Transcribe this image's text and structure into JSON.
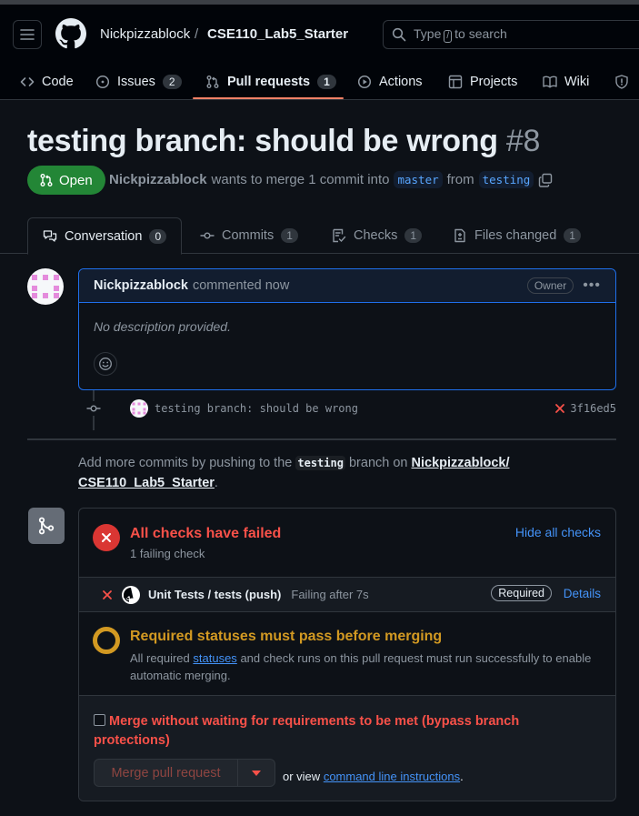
{
  "header": {
    "owner": "Nickpizzablock",
    "separator": "/",
    "repo": "CSE110_Lab5_Starter",
    "search_prefix": "Type",
    "search_key": "/",
    "search_suffix": "to search"
  },
  "repo_tabs": [
    {
      "label": "Code",
      "count": null,
      "icon": "code-icon"
    },
    {
      "label": "Issues",
      "count": "2",
      "icon": "issue-icon"
    },
    {
      "label": "Pull requests",
      "count": "1",
      "icon": "pull-request-icon"
    },
    {
      "label": "Actions",
      "count": null,
      "icon": "play-icon"
    },
    {
      "label": "Projects",
      "count": null,
      "icon": "table-icon"
    },
    {
      "label": "Wiki",
      "count": null,
      "icon": "book-icon"
    }
  ],
  "pr": {
    "title": "testing branch: should be wrong",
    "number": "#8",
    "state": "Open",
    "author": "Nickpizzablock",
    "merge_text": "wants to merge 1 commit into",
    "base_branch": "master",
    "from_text": "from",
    "head_branch": "testing"
  },
  "pr_tabs": [
    {
      "label": "Conversation",
      "count": "0"
    },
    {
      "label": "Commits",
      "count": "1"
    },
    {
      "label": "Checks",
      "count": "1"
    },
    {
      "label": "Files changed",
      "count": "1"
    }
  ],
  "comment": {
    "author": "Nickpizzablock",
    "time": "commented now",
    "badge": "Owner",
    "body": "No description provided."
  },
  "commit": {
    "message": "testing branch: should be wrong",
    "sha": "3f16ed5"
  },
  "add_commits": {
    "prefix": "Add more commits by pushing to the",
    "branch": "testing",
    "middle": "branch on",
    "repo_line1": "Nickpizzablock/",
    "repo_line2": "CSE110_Lab5_Starter",
    "suffix": "."
  },
  "checks": {
    "title": "All checks have failed",
    "subtitle": "1 failing check",
    "hide_label": "Hide all checks",
    "check_name": "Unit Tests / tests (push)",
    "check_status": "Failing after 7s",
    "required_badge": "Required",
    "details_label": "Details"
  },
  "requirements": {
    "title": "Required statuses must pass before merging",
    "desc_prefix": "All required",
    "desc_link": "statuses",
    "desc_suffix": "and check runs on this pull request must run successfully to enable automatic merging."
  },
  "merge": {
    "bypass_label": "Merge without waiting for requirements to be met (bypass branch protections)",
    "button_label": "Merge pull request",
    "or_view": "or view",
    "cli_link": "command line instructions",
    "period": "."
  },
  "colors": {
    "background": "#0d1117",
    "accent_blue": "#4493f8",
    "open_green": "#238636",
    "fail_red": "#da3633",
    "pending_yellow": "#d29922",
    "tab_underline": "#f78166"
  }
}
